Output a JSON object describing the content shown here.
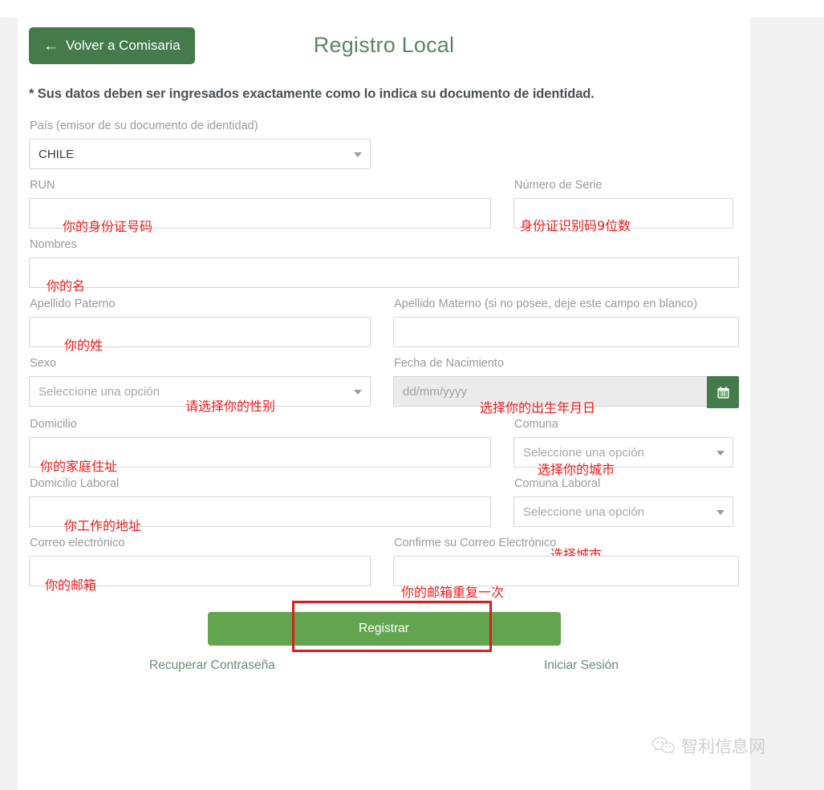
{
  "header": {
    "back_label": "Volver a Comisaria",
    "back_arrow": "←",
    "title": "Registro Local"
  },
  "notice": "* Sus datos deben ser ingresados exactamente como lo indica su documento de identidad.",
  "fields": {
    "pais": {
      "label": "País (emisor de su documento de identidad)",
      "value": "CHILE"
    },
    "run": {
      "label": "RUN",
      "value": ""
    },
    "numero_serie": {
      "label": "Número de Serie",
      "value": ""
    },
    "nombres": {
      "label": "Nombres",
      "value": ""
    },
    "apellido_paterno": {
      "label": "Apellido Paterno",
      "value": ""
    },
    "apellido_materno": {
      "label": "Apellido Materno (si no posee, deje este campo en blanco)",
      "value": ""
    },
    "sexo": {
      "label": "Sexo",
      "placeholder": "Seleccione una opción"
    },
    "fecha_nacimiento": {
      "label": "Fecha de Nacimiento",
      "placeholder": "dd/mm/yyyy"
    },
    "domicilio": {
      "label": "Domicilio",
      "value": ""
    },
    "comuna": {
      "label": "Comuna",
      "placeholder": "Seleccione una opción"
    },
    "domicilio_laboral": {
      "label": "Domicilio Laboral",
      "value": ""
    },
    "comuna_laboral": {
      "label": "Comuna Laboral",
      "placeholder": "Seleccione una opción"
    },
    "correo": {
      "label": "Correo electrónico",
      "value": ""
    },
    "correo_confirm": {
      "label": "Confirme su Correo Electrónico",
      "value": ""
    }
  },
  "footer": {
    "submit_label": "Registrar",
    "recover_label": "Recuperar Contraseña",
    "login_label": "Iniciar Sesión"
  },
  "annotations": {
    "run": "你的身份证号码",
    "numero_serie": "身份证识别码9位数",
    "nombres": "你的名",
    "apellido_paterno": "你的姓",
    "sexo": "请选择你的性别",
    "fecha_nacimiento": "选择你的出生年月日",
    "domicilio": "你的家庭住址",
    "comuna": "选择你的城市",
    "domicilio_laboral": "你工作的地址",
    "comuna_laboral": "选择城市",
    "correo": "你的邮箱",
    "correo_confirm": "你的邮箱重复一次"
  },
  "watermark": {
    "text": "智利信息网"
  },
  "colors": {
    "back_button_green": "#457a4b",
    "submit_green": "#63a44e",
    "title_green": "#5c8468",
    "link_green": "#6b8c74",
    "annotation_red": "#ef1c1c",
    "highlight_red": "#e01b1b"
  }
}
